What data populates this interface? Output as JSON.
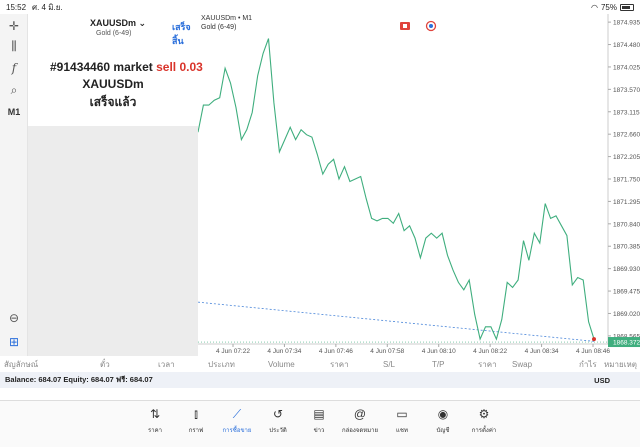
{
  "status_bar": {
    "time": "15:52",
    "date": "ศ. 4 มิ.ย.",
    "battery": "75%"
  },
  "toolbar": {
    "timeframe": "M1"
  },
  "header": {
    "symbol": "XAUUSDm",
    "subtitle": "Gold (6-49)",
    "done_label": "เสร็จสิ้น"
  },
  "order": {
    "ticket": "#91434460 market",
    "side": "sell",
    "volume": "0.03",
    "symbol": "XAUUSDm",
    "status": "เสร็จแล้ว"
  },
  "chart": {
    "symbol_line": "XAUUSDm • M1",
    "subtitle": "Gold (6-49)",
    "line_color": "#3fae7e",
    "current_price": "1868.372"
  },
  "chart_data": {
    "type": "line",
    "y_ticks": [
      "1874.935",
      "1874.480",
      "1874.025",
      "1873.570",
      "1873.115",
      "1872.660",
      "1872.205",
      "1871.750",
      "1871.295",
      "1870.840",
      "1870.385",
      "1869.930",
      "1869.475",
      "1869.020",
      "1868.565"
    ],
    "x_ticks": [
      "4 Jun 07:22",
      "4 Jun 07:34",
      "4 Jun 07:46",
      "4 Jun 07:58",
      "4 Jun 08:10",
      "4 Jun 08:22",
      "4 Jun 08:34",
      "4 Jun 08:46"
    ],
    "ylim": [
      1868.4,
      1875.1
    ],
    "values": [
      1872.7,
      1873.25,
      1873.25,
      1873.35,
      1873.4,
      1874.0,
      1873.7,
      1873.2,
      1872.55,
      1872.75,
      1873.1,
      1873.85,
      1874.3,
      1874.6,
      1873.3,
      1872.3,
      1872.55,
      1872.8,
      1872.55,
      1872.75,
      1872.65,
      1872.6,
      1872.25,
      1871.85,
      1872.05,
      1872.15,
      1871.75,
      1872.0,
      1871.7,
      1871.75,
      1871.8,
      1871.35,
      1870.95,
      1870.9,
      1870.95,
      1870.95,
      1870.85,
      1871.05,
      1870.7,
      1870.8,
      1870.55,
      1870.15,
      1870.55,
      1870.65,
      1870.55,
      1870.65,
      1870.2,
      1869.9,
      1869.65,
      1869.5,
      1869.7,
      1869.0,
      1868.5,
      1868.75,
      1868.75,
      1868.5,
      1868.9,
      1869.65,
      1869.55,
      1869.7,
      1870.5,
      1870.1,
      1870.65,
      1870.45,
      1871.25,
      1870.95,
      1871.0,
      1870.8,
      1870.6,
      1869.6,
      1869.75,
      1869.7,
      1868.85,
      1868.5
    ]
  },
  "columns": [
    "สัญลักษณ์",
    "ตั๋ว",
    "เวลา",
    "ประเภท",
    "Volume",
    "ราคา",
    "S/L",
    "T/P",
    "ราคา",
    "Swap",
    "กำไร",
    "หมายเหตุ"
  ],
  "balance": {
    "text": "Balance: 684.07  Equity: 684.07  ฟรี: 684.07",
    "currency": "USD"
  },
  "nav": [
    {
      "label": "ราคา",
      "icon": "quotes-icon"
    },
    {
      "label": "กราฟ",
      "icon": "chart-icon"
    },
    {
      "label": "การซื้อขาย",
      "icon": "trade-icon"
    },
    {
      "label": "ประวัติ",
      "icon": "history-icon"
    },
    {
      "label": "ข่าว",
      "icon": "news-icon"
    },
    {
      "label": "กล่องจดหมาย",
      "icon": "mailbox-icon"
    },
    {
      "label": "แชท",
      "icon": "chat-icon"
    },
    {
      "label": "บัญชี",
      "icon": "account-icon"
    },
    {
      "label": "การตั้งค่า",
      "icon": "settings-icon"
    }
  ]
}
